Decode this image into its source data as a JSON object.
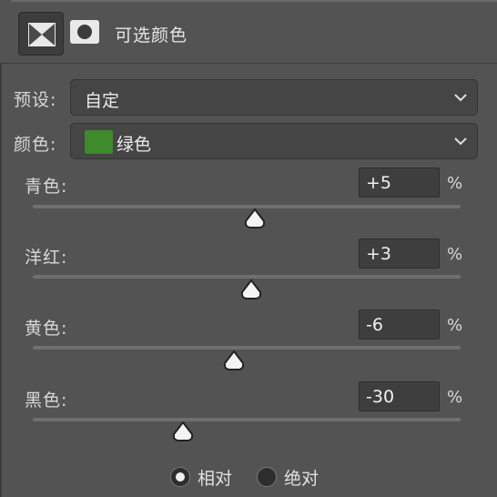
{
  "header": {
    "title": "可选颜色",
    "adjustment_icon": "selective-color-icon",
    "mask_icon": "layer-mask-icon"
  },
  "preset": {
    "label": "预设:",
    "value": "自定"
  },
  "colors": {
    "label": "颜色:",
    "value": "绿色",
    "swatch_color": "#3f8a2a"
  },
  "sliders": [
    {
      "label": "青色:",
      "value": "+5",
      "unit": "%",
      "level": 0.52
    },
    {
      "label": "洋红:",
      "value": "+3",
      "unit": "%",
      "level": 0.51
    },
    {
      "label": "黄色:",
      "value": "-6",
      "unit": "%",
      "level": 0.47
    },
    {
      "label": "黑色:",
      "value": "-30",
      "unit": "%",
      "level": 0.35
    }
  ],
  "method": {
    "options": [
      "相对",
      "绝对"
    ],
    "selected": "相对"
  }
}
